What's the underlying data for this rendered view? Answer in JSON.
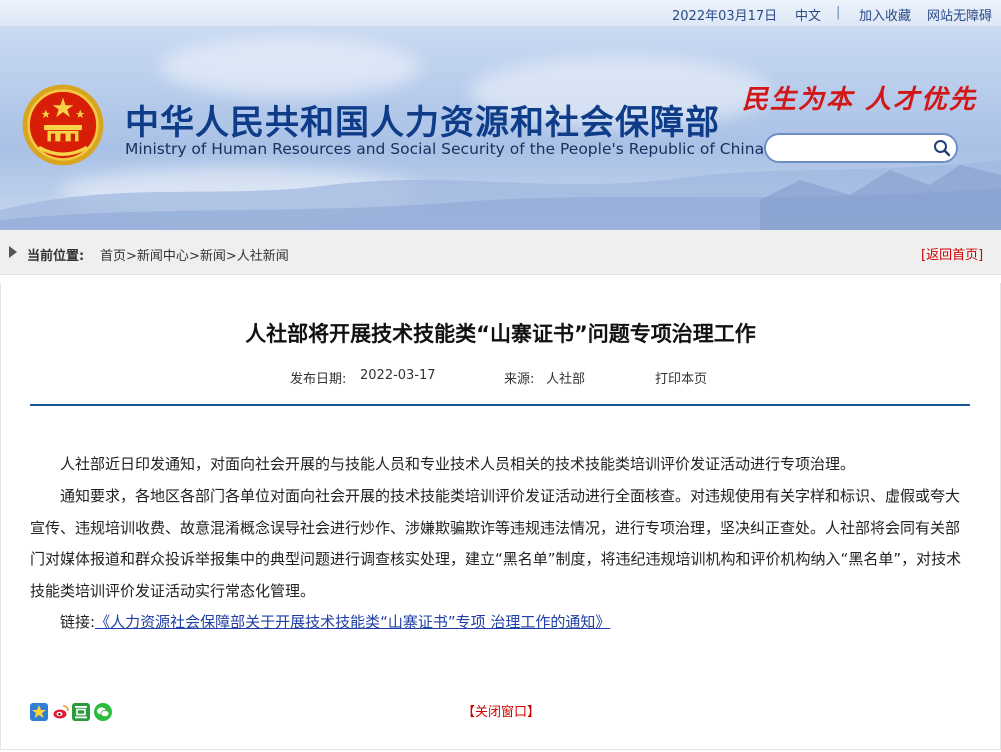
{
  "topbar": {
    "date": "2022年03月17日",
    "lang": "中文",
    "separator": "|",
    "favorite": "加入收藏",
    "accessibility": "网站无障碍"
  },
  "header": {
    "title_cn": "中华人民共和国人力资源和社会保障部",
    "title_en": "Ministry of Human Resources and Social Security of the People's Republic of China",
    "slogan": "民生为本 人才优先",
    "search": {
      "placeholder": "",
      "value": ""
    }
  },
  "breadcrumb": {
    "label": "当前位置:",
    "items": [
      "首页",
      "新闻中心",
      "新闻",
      "人社新闻"
    ],
    "separator": ">",
    "back_home": "[返回首页]"
  },
  "article": {
    "title": "人社部将开展技术技能类“山寨证书”问题专项治理工作",
    "publish_date_label": "发布日期:",
    "publish_date": "2022-03-17",
    "source_label": "来源:",
    "source": "人社部",
    "print": "打印本页",
    "paragraphs": [
      "人社部近日印发通知，对面向社会开展的与技能人员和专业技术人员相关的技术技能类培训评价发证活动进行专项治理。",
      "通知要求，各地区各部门各单位对面向社会开展的技术技能类培训评价发证活动进行全面核查。对违规使用有关字样和标识、虚假或夸大宣传、违规培训收费、故意混淆概念误导社会进行炒作、涉嫌欺骗欺诈等违规违法情况，进行专项治理，坚决纠正查处。人社部将会同有关部门对媒体报道和群众投诉举报集中的典型问题进行调查核实处理，建立“黑名单”制度，将违纪违规培训机构和评价机构纳入“黑名单”，对技术技能类培训评价发证活动实行常态化管理。"
    ],
    "link_label": "链接:",
    "link_text": "《人力资源社会保障部关于开展技术技能类“山寨证书”专项 治理工作的通知》"
  },
  "footer": {
    "close_window": "【关闭窗口】",
    "share_icons": [
      "qzone-icon",
      "weibo-icon",
      "douban-icon",
      "wechat-icon"
    ]
  },
  "colors": {
    "brand_blue": "#0e3c88",
    "accent_red": "#c00",
    "rule_blue": "#1b5794"
  }
}
